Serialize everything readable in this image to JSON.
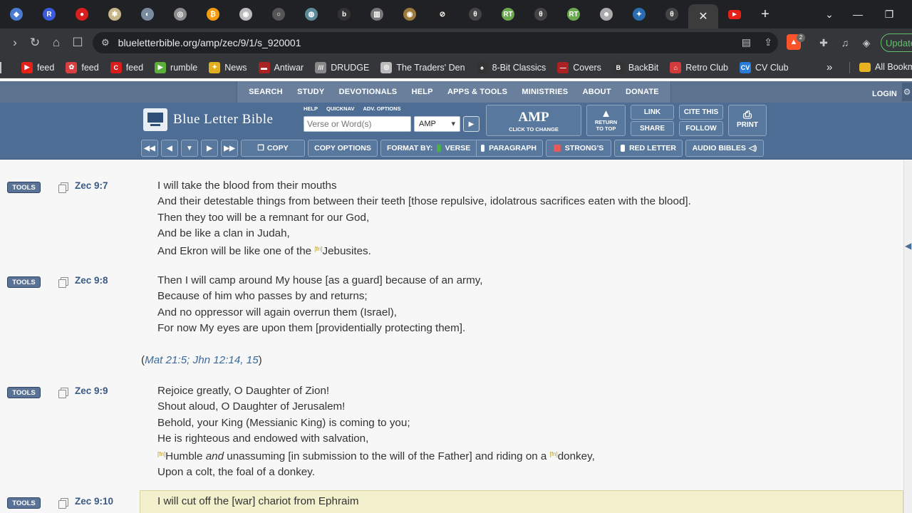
{
  "browser": {
    "tabs": [
      {
        "icon": "cube-favicon-icon",
        "color": "#4a7bd0",
        "glyph": "◆"
      },
      {
        "icon": "r-favicon-icon",
        "color": "#3b5bdb",
        "glyph": "R"
      },
      {
        "icon": "red-circle-favicon-icon",
        "color": "#d81e1e",
        "glyph": "●"
      },
      {
        "icon": "compass-favicon-icon",
        "color": "#c9b58a",
        "glyph": "✱"
      },
      {
        "icon": "globe-favicon-icon",
        "color": "#7a8ba0",
        "glyph": "◐"
      },
      {
        "icon": "gear-favicon-icon",
        "color": "#8d8d8d",
        "glyph": "◎"
      },
      {
        "icon": "bitcoin-favicon-icon",
        "color": "#f39c12",
        "glyph": "₿"
      },
      {
        "icon": "shield-favicon-icon",
        "color": "#bbbbbb",
        "glyph": "◉"
      },
      {
        "icon": "circle-favicon-icon",
        "color": "#555555",
        "glyph": "○"
      },
      {
        "icon": "earth-favicon-icon",
        "color": "#5d8a9a",
        "glyph": "◍"
      },
      {
        "icon": "b-favicon-icon",
        "color": "#333333",
        "glyph": "b"
      },
      {
        "icon": "columns-favicon-icon",
        "color": "#777777",
        "glyph": "▥"
      },
      {
        "icon": "coin-favicon-icon",
        "color": "#9c7a3c",
        "glyph": "◉"
      },
      {
        "icon": "slash-circle-favicon-icon",
        "color": "#222222",
        "glyph": "⊘"
      },
      {
        "icon": "theta-favicon-icon",
        "color": "#444444",
        "glyph": "θ"
      },
      {
        "icon": "rt-favicon-icon",
        "color": "#6aa84f",
        "glyph": "RT"
      },
      {
        "icon": "theta2-favicon-icon",
        "color": "#444444",
        "glyph": "θ"
      },
      {
        "icon": "rt2-favicon-icon",
        "color": "#6aa84f",
        "glyph": "RT"
      },
      {
        "icon": "person-favicon-icon",
        "color": "#aaaaaa",
        "glyph": "☻"
      },
      {
        "icon": "bird-favicon-icon",
        "color": "#2b6cb0",
        "glyph": "✦"
      },
      {
        "icon": "theta3-favicon-icon",
        "color": "#444444",
        "glyph": "θ"
      }
    ],
    "active_tab_close": "✕",
    "new_tab": "+",
    "url": "blueletterbible.org/amp/zec/9/1/s_920001",
    "update_label": "Update",
    "brave_badge": "2"
  },
  "bookmarks": [
    {
      "label": "feed",
      "icon": "youtube-icon",
      "color": "#e62117",
      "glyph": "▶"
    },
    {
      "label": "feed",
      "icon": "paw-icon",
      "color": "#d94040",
      "glyph": "✿"
    },
    {
      "label": "feed",
      "icon": "c-icon",
      "color": "#d91c1c",
      "glyph": "C"
    },
    {
      "label": "rumble",
      "icon": "rumble-icon",
      "color": "#5cae3a",
      "glyph": "▶"
    },
    {
      "label": "News",
      "icon": "star-icon",
      "color": "#e0b020",
      "glyph": "✦"
    },
    {
      "label": "Antiwar",
      "icon": "antiwar-icon",
      "color": "#aa2222",
      "glyph": "▬"
    },
    {
      "label": "DRUDGE",
      "icon": "drudge-icon",
      "color": "#888888",
      "glyph": "///"
    },
    {
      "label": "The Traders' Den",
      "icon": "traders-den-icon",
      "color": "#bbbbbb",
      "glyph": "◎"
    },
    {
      "label": "8-Bit Classics",
      "icon": "joystick-icon",
      "color": "#333333",
      "glyph": "♠"
    },
    {
      "label": "Covers",
      "icon": "covers-icon",
      "color": "#aa2222",
      "glyph": "—"
    },
    {
      "label": "BackBit",
      "icon": "backbit-icon",
      "color": "#333333",
      "glyph": "B"
    },
    {
      "label": "Retro Club",
      "icon": "retro-club-icon",
      "color": "#d33b3b",
      "glyph": "⌂"
    },
    {
      "label": "CV Club",
      "icon": "cv-club-icon",
      "color": "#2a7bd6",
      "glyph": "CV"
    }
  ],
  "bookmarks_more": "»",
  "bookmarks_folder": "All Bookm",
  "site": {
    "topnav": [
      "SEARCH",
      "STUDY",
      "DEVOTIONALS",
      "HELP",
      "APPS & TOOLS",
      "MINISTRIES",
      "ABOUT",
      "DONATE"
    ],
    "login": "LOGIN",
    "logo_text": "Blue Letter Bible",
    "small_links": [
      "HELP",
      "QUICKNAV",
      "ADV. OPTIONS"
    ],
    "search_placeholder": "Verse or Word(s)",
    "version": "AMP",
    "amp_big": "AMP",
    "amp_sub": "CLICK TO CHANGE",
    "return_top": [
      "RETURN",
      "TO TOP"
    ],
    "link": "LINK",
    "share": "SHARE",
    "cite": "CITE THIS",
    "follow": "FOLLOW",
    "print": "PRINT",
    "toolbar": {
      "copy": "COPY",
      "copy_options": "COPY OPTIONS",
      "format_by": "FORMAT BY:",
      "verse": "VERSE",
      "paragraph": "PARAGRAPH",
      "strongs": "STRONG'S",
      "red_letter": "RED LETTER",
      "audio": "AUDIO BIBLES"
    }
  },
  "verses": [
    {
      "ref": "Zec 9:7",
      "tools": "TOOLS",
      "lines": [
        {
          "pre": "",
          "fn": "",
          "text": "I will take the blood from their mouths"
        },
        {
          "pre": "",
          "fn": "",
          "text": "And their detestable things from between their teeth [those repulsive, idolatrous sacrifices eaten with the blood]."
        },
        {
          "pre": "",
          "fn": "",
          "text": "Then they too will be a remnant for our God,"
        },
        {
          "pre": "",
          "fn": "",
          "text": "And be like a clan in Judah,"
        },
        {
          "pre": "And Ekron will be like one of the ",
          "fn": "[fn]",
          "text": "Jebusites."
        }
      ]
    },
    {
      "ref": "Zec 9:8",
      "tools": "TOOLS",
      "lines": [
        {
          "pre": "",
          "fn": "",
          "text": "Then I will camp around My house [as a guard] because of an army,"
        },
        {
          "pre": "",
          "fn": "",
          "text": "Because of him who passes by and returns;"
        },
        {
          "pre": "",
          "fn": "",
          "text": "And no oppressor will again overrun them (Israel),"
        },
        {
          "pre": "",
          "fn": "",
          "text": "For now My eyes are upon them [providentially protecting them]."
        }
      ]
    },
    {
      "ref": "Zec 9:9",
      "tools": "TOOLS",
      "lines": [
        {
          "pre": "",
          "fn": "",
          "text": "Rejoice greatly, O Daughter of Zion!"
        },
        {
          "pre": "",
          "fn": "",
          "text": "Shout aloud, O Daughter of Jerusalem!"
        },
        {
          "pre": "",
          "fn": "",
          "text": "Behold, your King (Messianic King) is coming to you;"
        },
        {
          "pre": "",
          "fn": "",
          "text": "He is righteous and endowed with salvation,"
        }
      ],
      "line5": {
        "fn1": "[fn]",
        "a": "Humble ",
        "em": "and",
        "b": " unassuming [in submission to the will of the Father] and riding on a ",
        "fn2": "[fn]",
        "c": "donkey,"
      },
      "line6": "Upon a colt, the foal of a donkey."
    },
    {
      "ref": "Zec 9:10",
      "tools": "TOOLS",
      "lines": [
        {
          "pre": "",
          "fn": "",
          "text": "I will cut off the [war] chariot from Ephraim"
        }
      ]
    }
  ],
  "crossref": {
    "open": "(",
    "refs": "Mat 21:5; Jhn 12:14, 15",
    "close": ")"
  }
}
